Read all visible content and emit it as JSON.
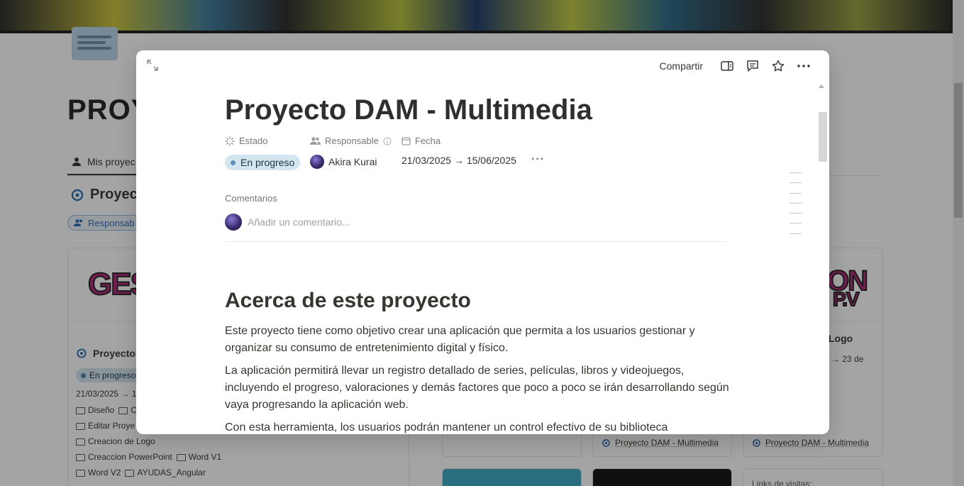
{
  "background_page": {
    "title_partial": "PROY",
    "tab_label": "Mis proyec",
    "view_title": "Proyec",
    "filter_label": "Responsab",
    "card_left": {
      "logo_text": "GES",
      "title": "Proyecto",
      "status": "En progreso",
      "date": "21/03/2025 → 1",
      "tags": [
        [
          "Diseño",
          "C"
        ],
        [
          "Editar Proye"
        ],
        [
          "Creacion de Logo"
        ],
        [
          "Creaccion PowerPoint",
          "Word V1"
        ],
        [
          "Word V2",
          "AYUDAS_Angular"
        ]
      ]
    },
    "card_right": {
      "logo_text": "ON",
      "logo_sub": "P.V",
      "title_partial": "Logo",
      "date_partial": "5 → 23 de",
      "relation_label": "Proyecto DAM - Multimedia"
    },
    "card_mid": {
      "relation_label": "Proyecto DAM - Multimedia"
    },
    "footer_partial": "Links de visitas:"
  },
  "modal": {
    "toolbar": {
      "share_label": "Compartir",
      "icons": [
        "expand-icon",
        "side-peek-icon",
        "comment-icon",
        "star-icon",
        "more-icon"
      ]
    },
    "title": "Proyecto DAM - Multimedia",
    "properties": {
      "estado": {
        "label": "Estado",
        "value": "En progreso"
      },
      "responsable": {
        "label": "Responsable",
        "value": "Akira Kurai"
      },
      "fecha": {
        "label": "Fecha",
        "value": "21/03/2025 → 15/06/2025"
      }
    },
    "comments": {
      "label": "Comentarios",
      "placeholder": "Añadir un comentario..."
    },
    "section_heading": "Acerca de este proyecto",
    "paragraphs": [
      "Este proyecto tiene como objetivo crear una aplicación que permita a los usuarios gestionar y organizar su consumo de entretenimiento digital y físico.",
      "La aplicación permitirá llevar un registro detallado de series, películas, libros y videojuegos, incluyendo el progreso, valoraciones y demás factores que poco a poco se irán desarrollando según vaya progresando la aplicación web.",
      "Con esta herramienta, los usuarios podrán mantener un control efectivo de su biblioteca"
    ]
  },
  "colors": {
    "status_bg": "#d3e5ef",
    "status_dot": "#5b8fba",
    "overlay": "rgba(15,15,15,0.38)"
  }
}
